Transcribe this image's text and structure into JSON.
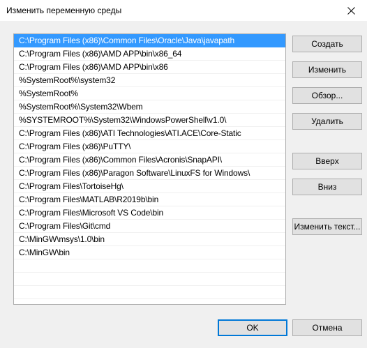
{
  "window": {
    "title": "Изменить переменную среды",
    "close_label": "✕"
  },
  "list": {
    "items": [
      "C:\\Program Files (x86)\\Common Files\\Oracle\\Java\\javapath",
      "C:\\Program Files (x86)\\AMD APP\\bin\\x86_64",
      "C:\\Program Files (x86)\\AMD APP\\bin\\x86",
      "%SystemRoot%\\system32",
      "%SystemRoot%",
      "%SystemRoot%\\System32\\Wbem",
      "%SYSTEMROOT%\\System32\\WindowsPowerShell\\v1.0\\",
      "C:\\Program Files (x86)\\ATI Technologies\\ATI.ACE\\Core-Static",
      "C:\\Program Files (x86)\\PuTTY\\",
      "C:\\Program Files (x86)\\Common Files\\Acronis\\SnapAPI\\",
      "C:\\Program Files (x86)\\Paragon Software\\LinuxFS for Windows\\",
      "C:\\Program Files\\TortoiseHg\\",
      "C:\\Program Files\\MATLAB\\R2019b\\bin",
      "C:\\Program Files\\Microsoft VS Code\\bin",
      "C:\\Program Files\\Git\\cmd",
      "C:\\MinGW\\msys\\1.0\\bin",
      "C:\\MinGW\\bin"
    ],
    "selected_index": 0
  },
  "buttons": {
    "create": "Создать",
    "edit": "Изменить",
    "browse": "Обзор...",
    "delete": "Удалить",
    "up": "Вверх",
    "down": "Вниз",
    "edit_text": "Изменить текст..."
  },
  "footer": {
    "ok": "OK",
    "cancel": "Отмена"
  },
  "colors": {
    "selection": "#3399ff",
    "accent_border": "#0078d7",
    "button_face": "#e1e1e1"
  }
}
